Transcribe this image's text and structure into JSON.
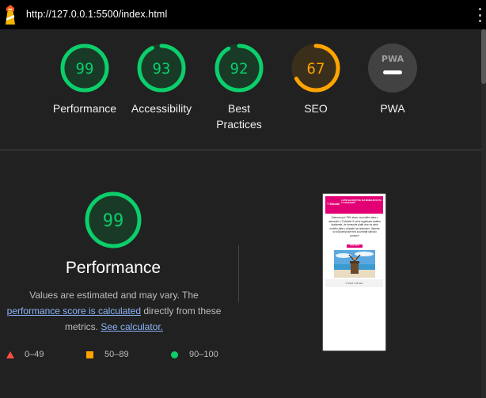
{
  "topbar": {
    "url": "http://127.0.0.1:5500/index.html",
    "logo_icon": "lighthouse-icon",
    "menu_icon": "kebab-menu-icon"
  },
  "colors": {
    "pass": "#0cce6b",
    "pass_bg": "#183a27",
    "average": "#ffa400",
    "average_bg": "#3a2f1a",
    "fail": "#ff4e42",
    "neutral": "#9e9e9e",
    "link": "#8ab4f8",
    "brand": "#e20074"
  },
  "summary": {
    "gauges": [
      {
        "label": "Performance",
        "score": "99",
        "value": 99
      },
      {
        "label": "Accessibility",
        "score": "93",
        "value": 93
      },
      {
        "label_line1": "Best",
        "label_line2": "Practices",
        "score": "92",
        "value": 92
      },
      {
        "label": "SEO",
        "score": "67",
        "value": 67
      },
      {
        "label": "PWA",
        "badge": "PWA",
        "icon": "pwa-dash-icon"
      }
    ]
  },
  "performance": {
    "score": "99",
    "value": 99,
    "title": "Performance",
    "desc_text": "Values are estimated and may vary. The",
    "desc_link": "performance score is calculated",
    "desc_mid": "directly from these metrics.",
    "desc_link2": "See calculator.",
    "legend": [
      {
        "range": "0–49",
        "icon": "fail-triangle-icon"
      },
      {
        "range": "50–89",
        "icon": "average-square-icon"
      },
      {
        "range": "90–100",
        "icon": "pass-circle-icon"
      }
    ]
  },
  "thumbnail": {
    "brand": "T Mobile",
    "headline": "LETNÍ BLOKÁTOR, NA MOBILNÍ DATA V ZAHRANIČÍ",
    "body": "Zdarma nyní 75% slevu na mobilní data v zahraničí s T-Mobile! S roční registrace tarifem dostanete, že nemusíte platit více za vaše mobilní data v případě na cestování. Vyberte si svůj tarif právě teď a užívejte výhodu pomocí!",
    "cta": "VÍCE INFO",
    "footer": "© 2023 T-Mobile"
  }
}
